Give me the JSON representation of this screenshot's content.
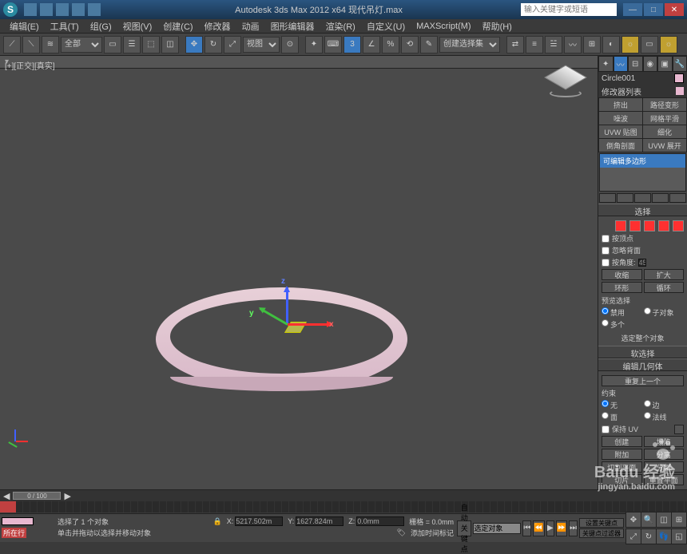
{
  "titlebar": {
    "app_title": "Autodesk 3ds Max 2012 x64   现代吊灯.max",
    "search_placeholder": "输入关键字或短语"
  },
  "menu": {
    "items": [
      "编辑(E)",
      "工具(T)",
      "组(G)",
      "视图(V)",
      "创建(C)",
      "修改器",
      "动画",
      "图形编辑器",
      "渲染(R)",
      "自定义(U)",
      "MAXScript(M)",
      "帮助(H)"
    ]
  },
  "toolbar": {
    "selection_filter": "全部",
    "view_dd": "视图",
    "selset_dd": "创建选择集"
  },
  "viewport": {
    "label": "[+][正交][真实]",
    "axis": {
      "x": "x",
      "y": "y",
      "z": "z"
    }
  },
  "cmd": {
    "object_name": "Circle001",
    "modifier_list": "修改器列表",
    "mod_buttons": [
      "挤出",
      "路径变形",
      "噪波",
      "网格平滑",
      "UVW 贴图",
      "细化",
      "倒角剖面",
      "UVW 展开"
    ],
    "stack_item": "可编辑多边形",
    "sel_rollout": "选择",
    "by_vertex": "按顶点",
    "ignore_backfacing": "忽略背面",
    "by_angle": "按角度:",
    "angle_val": "45.0",
    "shrink": "收缩",
    "grow": "扩大",
    "ring": "环形",
    "loop": "循环",
    "preview_sel": "预览选择",
    "preview_opts": [
      "禁用",
      "子对象",
      "多个"
    ],
    "sel_whole": "选定整个对象",
    "soft_sel": "软选择",
    "edit_geom": "编辑几何体",
    "repeat_last": "重复上一个",
    "constraints": "约束",
    "c_none": "无",
    "c_edge": "边",
    "c_face": "面",
    "c_normal": "法线",
    "preserve_uv": "保持 UV",
    "create": "创建",
    "collapse": "塌陷",
    "attach": "附加",
    "detach": "分离",
    "slice_plane": "切割平面",
    "split": "分割",
    "slice": "切片",
    "reset_plane": "重置平面"
  },
  "timeline": {
    "frame": "0 / 100"
  },
  "status": {
    "none_exec": "所在行",
    "sel_info": "选择了 1 个对象",
    "hint": "单击并拖动以选择并移动对象",
    "x": "5217.502m",
    "y": "1627.824m",
    "z": "0.0mm",
    "grid": "栅格 = 0.0mm",
    "auto_key": "自动关键点",
    "sel_set": "选定对象",
    "set_key": "设置关键点",
    "key_filter": "关键点过滤器",
    "add_time_tag": "添加时间标记"
  },
  "watermark": {
    "brand": "Baidu 经验",
    "url": "jingyan.baidu.com"
  }
}
